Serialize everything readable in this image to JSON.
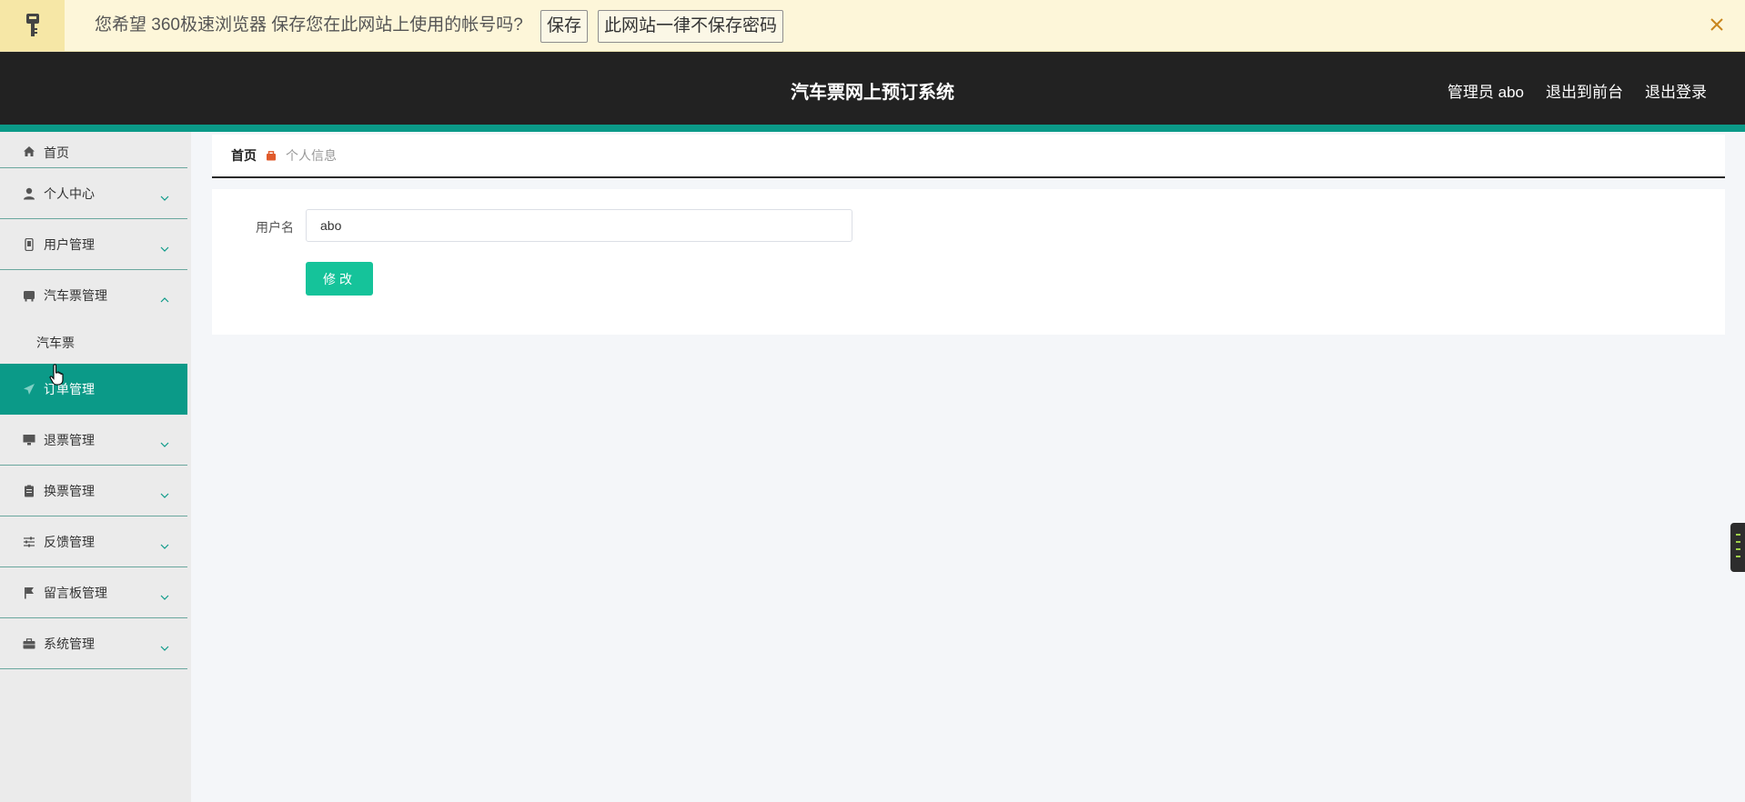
{
  "password_bar": {
    "message": "您希望 360极速浏览器 保存您在此网站上使用的帐号吗?",
    "save_label": "保存",
    "never_label": "此网站一律不保存密码"
  },
  "header": {
    "title": "汽车票网上预订系统",
    "admin_label": "管理员 abo",
    "to_front_label": "退出到前台",
    "logout_label": "退出登录"
  },
  "sidebar": {
    "items": [
      {
        "label": "首页",
        "icon": "home-icon"
      },
      {
        "label": "个人中心",
        "icon": "user-icon"
      },
      {
        "label": "用户管理",
        "icon": "phone-icon"
      },
      {
        "label": "汽车票管理",
        "icon": "bus-icon",
        "expanded": true,
        "sub": [
          "汽车票"
        ]
      },
      {
        "label": "订单管理",
        "icon": "send-icon",
        "active": true
      },
      {
        "label": "退票管理",
        "icon": "monitor-icon"
      },
      {
        "label": "换票管理",
        "icon": "clipboard-icon"
      },
      {
        "label": "反馈管理",
        "icon": "sliders-icon"
      },
      {
        "label": "留言板管理",
        "icon": "flag-icon"
      },
      {
        "label": "系统管理",
        "icon": "briefcase-icon"
      }
    ]
  },
  "breadcrumb": {
    "home": "首页",
    "current": "个人信息"
  },
  "form": {
    "username_label": "用户名",
    "username_value": "abo",
    "submit_label": "修改"
  },
  "colors": {
    "accent": "#0b9a88",
    "button": "#15c39a",
    "header_bg": "#222222"
  }
}
